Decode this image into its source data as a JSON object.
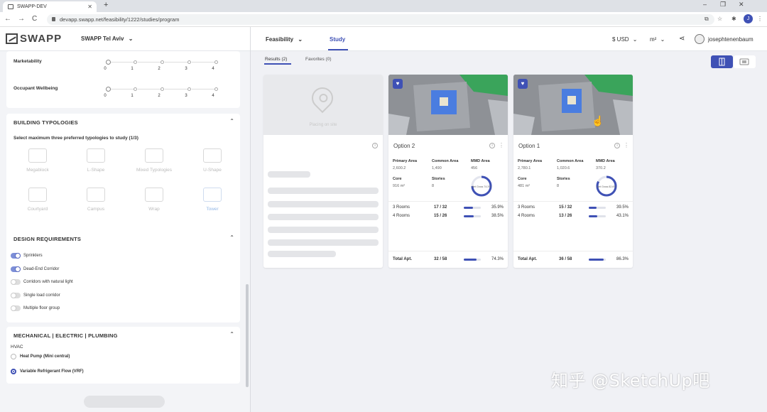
{
  "browser": {
    "tab_title": "SWAPP-DEV",
    "tab_close": "✕",
    "new_tab": "+",
    "win_min": "–",
    "win_max": "❐",
    "win_close": "✕",
    "back": "←",
    "forward": "→",
    "reload": "C",
    "url": "devapp.swapp.net/feasibility/1222/studies/program",
    "profile": "J"
  },
  "app": {
    "logo": "SWAPP",
    "project": "SWAPP Tel Aviv",
    "project_chevron": "⌄",
    "nav_feasibility": "Feasibility",
    "nav_feasibility_chevron": "⌄",
    "nav_study": "Study",
    "currency": "$ USD",
    "unit": "m²",
    "chevron": "⌄",
    "share": "⋖",
    "username": "josephtenenbaum"
  },
  "sidebar": {
    "ratings": [
      {
        "label": "Marketability"
      },
      {
        "label": "Occupant Wellbeing"
      }
    ],
    "scale": [
      "0",
      "1",
      "2",
      "3",
      "4"
    ],
    "building_typologies": {
      "title": "BUILDING TYPOLOGIES",
      "subtitle": "Select maximum three preferred typologies to study (1/3)",
      "items": [
        {
          "label": "Megablock"
        },
        {
          "label": "L-Shape"
        },
        {
          "label": "Mixed Typologies"
        },
        {
          "label": "U-Shape"
        },
        {
          "label": "Courtyard"
        },
        {
          "label": "Campus"
        },
        {
          "label": "Wrap"
        },
        {
          "label": "Tower"
        }
      ]
    },
    "design_requirements": {
      "title": "DESIGN REQUIREMENTS",
      "items": [
        {
          "label": "Sprinklers",
          "on": true
        },
        {
          "label": "Dead-End Corridor",
          "on": true
        },
        {
          "label": "Corridors with natural light",
          "on": false
        },
        {
          "label": "Single load corridor",
          "on": false
        },
        {
          "label": "Multiple floor group",
          "on": false
        }
      ]
    },
    "mep": {
      "title": "MECHANICAL | ELECTRIC | PLUMBING",
      "hvac_label": "HVAC",
      "options": [
        {
          "label": "Heat Pump (Mini central)",
          "selected": false
        },
        {
          "label": "Variable Refrigerant Flow (VRF)",
          "selected": true
        }
      ]
    },
    "collapse_chevron": "⌃"
  },
  "main": {
    "tab_results": "Results (2)",
    "tab_favorites": "Favorites (0)",
    "placeholder_text": "Placing on site",
    "info": "i",
    "more": "⋮",
    "heart": "♥",
    "cards": [
      {
        "title": "Option 2",
        "primary_label": "Primary Area",
        "primary_value": "2,600.2",
        "common_label": "Common Area",
        "common_value": "1,490",
        "mmd_label": "MMD Area",
        "mmd_value": "456",
        "core_label": "Core",
        "core_value": "916 m²",
        "stories_label": "Stories",
        "stories_value": "8",
        "ring_text": "Net Gross 74.3%",
        "ring_pct": 0.743,
        "rows": [
          {
            "label": "3 Rooms",
            "value": "17 / 32",
            "pct": "35.9%",
            "fill": 0.53
          },
          {
            "label": "4 Rooms",
            "value": "15 / 26",
            "pct": "38.5%",
            "fill": 0.58
          }
        ],
        "total_label": "Total Apt.",
        "total_value": "32 / 58",
        "total_pct": "74.3%",
        "total_fill": 0.74
      },
      {
        "title": "Option 1",
        "primary_label": "Primary Area",
        "primary_value": "2,780.1",
        "common_label": "Common Area",
        "common_value": "1,020.6",
        "mmd_label": "MMD Area",
        "mmd_value": "370.2",
        "core_label": "Core",
        "core_value": "481 m²",
        "stories_label": "Stories",
        "stories_value": "8",
        "ring_text": "Net Gross 82.6%",
        "ring_pct": 0.826,
        "rows": [
          {
            "label": "3 Rooms",
            "value": "15 / 32",
            "pct": "39.5%",
            "fill": 0.47
          },
          {
            "label": "4 Rooms",
            "value": "13 / 26",
            "pct": "43.1%",
            "fill": 0.5
          }
        ],
        "total_label": "Total Apt.",
        "total_value": "36 / 58",
        "total_pct": "86.3%",
        "total_fill": 0.86
      }
    ]
  },
  "watermark": "知乎 @SketchUp吧",
  "colors": {
    "accent": "#3f51b5",
    "green": "#3aa45b"
  }
}
